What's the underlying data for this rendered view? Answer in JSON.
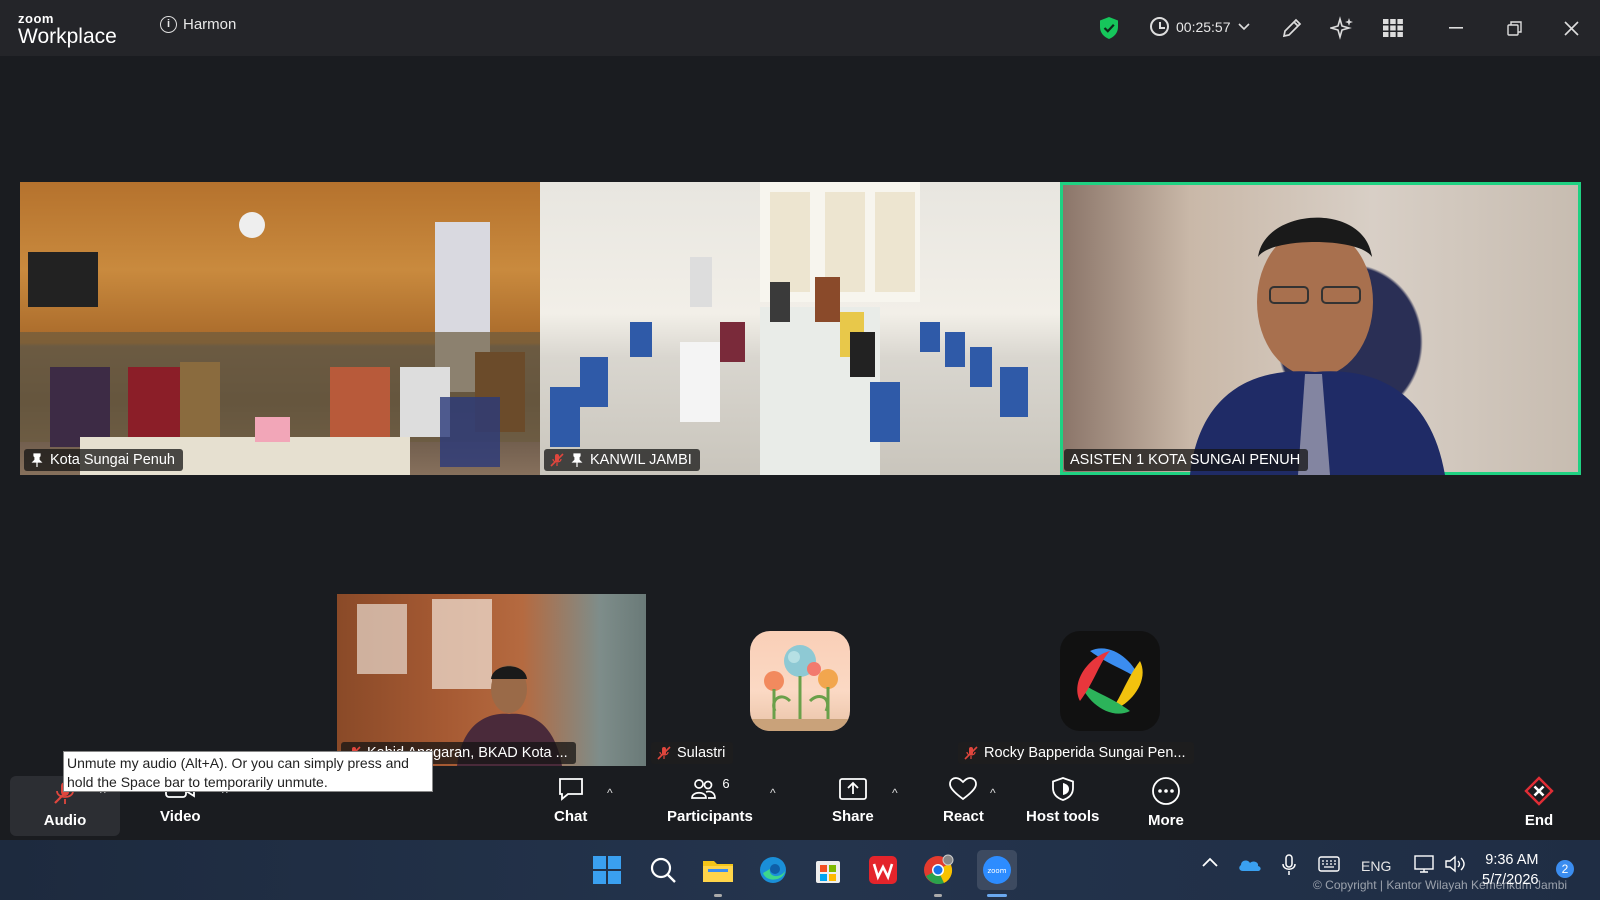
{
  "app": {
    "logo_small": "zoom",
    "logo_big": "Workplace"
  },
  "meeting": {
    "title": "Harmon",
    "timer": "00:25:57"
  },
  "participants": [
    {
      "name": "Kota Sungai Penuh",
      "pinned": true,
      "muted": false
    },
    {
      "name": "KANWIL JAMBI",
      "pinned": true,
      "muted": true
    },
    {
      "name": "ASISTEN 1 KOTA SUNGAI PENUH",
      "pinned": false,
      "muted": false,
      "active_speaker": true
    },
    {
      "name": "Kabid Anggaran, BKAD Kota ...",
      "muted": true
    },
    {
      "name": "Sulastri",
      "muted": true
    },
    {
      "name": "Rocky Bapperida Sungai Pen...",
      "muted": true
    }
  ],
  "tooltip": {
    "text_line1": "Unmute my audio (Alt+A). Or you can simply press and",
    "text_line2": "hold the Space bar to temporarily unmute."
  },
  "toolbar": {
    "audio": "Audio",
    "video": "Video",
    "chat": "Chat",
    "participants": "Participants",
    "participants_count": "6",
    "share": "Share",
    "react": "React",
    "host_tools": "Host tools",
    "more": "More",
    "end": "End"
  },
  "taskbar": {
    "language": "ENG",
    "time": "9:36 AM",
    "date": "5/7/2026",
    "notification_count": "2"
  },
  "watermark": "© Copyright | Kantor Wilayah Kemenkum Jambi",
  "colors": {
    "active_speaker_border": "#1fd182",
    "end_red": "#e02d35",
    "shield_green": "#16c65b"
  }
}
